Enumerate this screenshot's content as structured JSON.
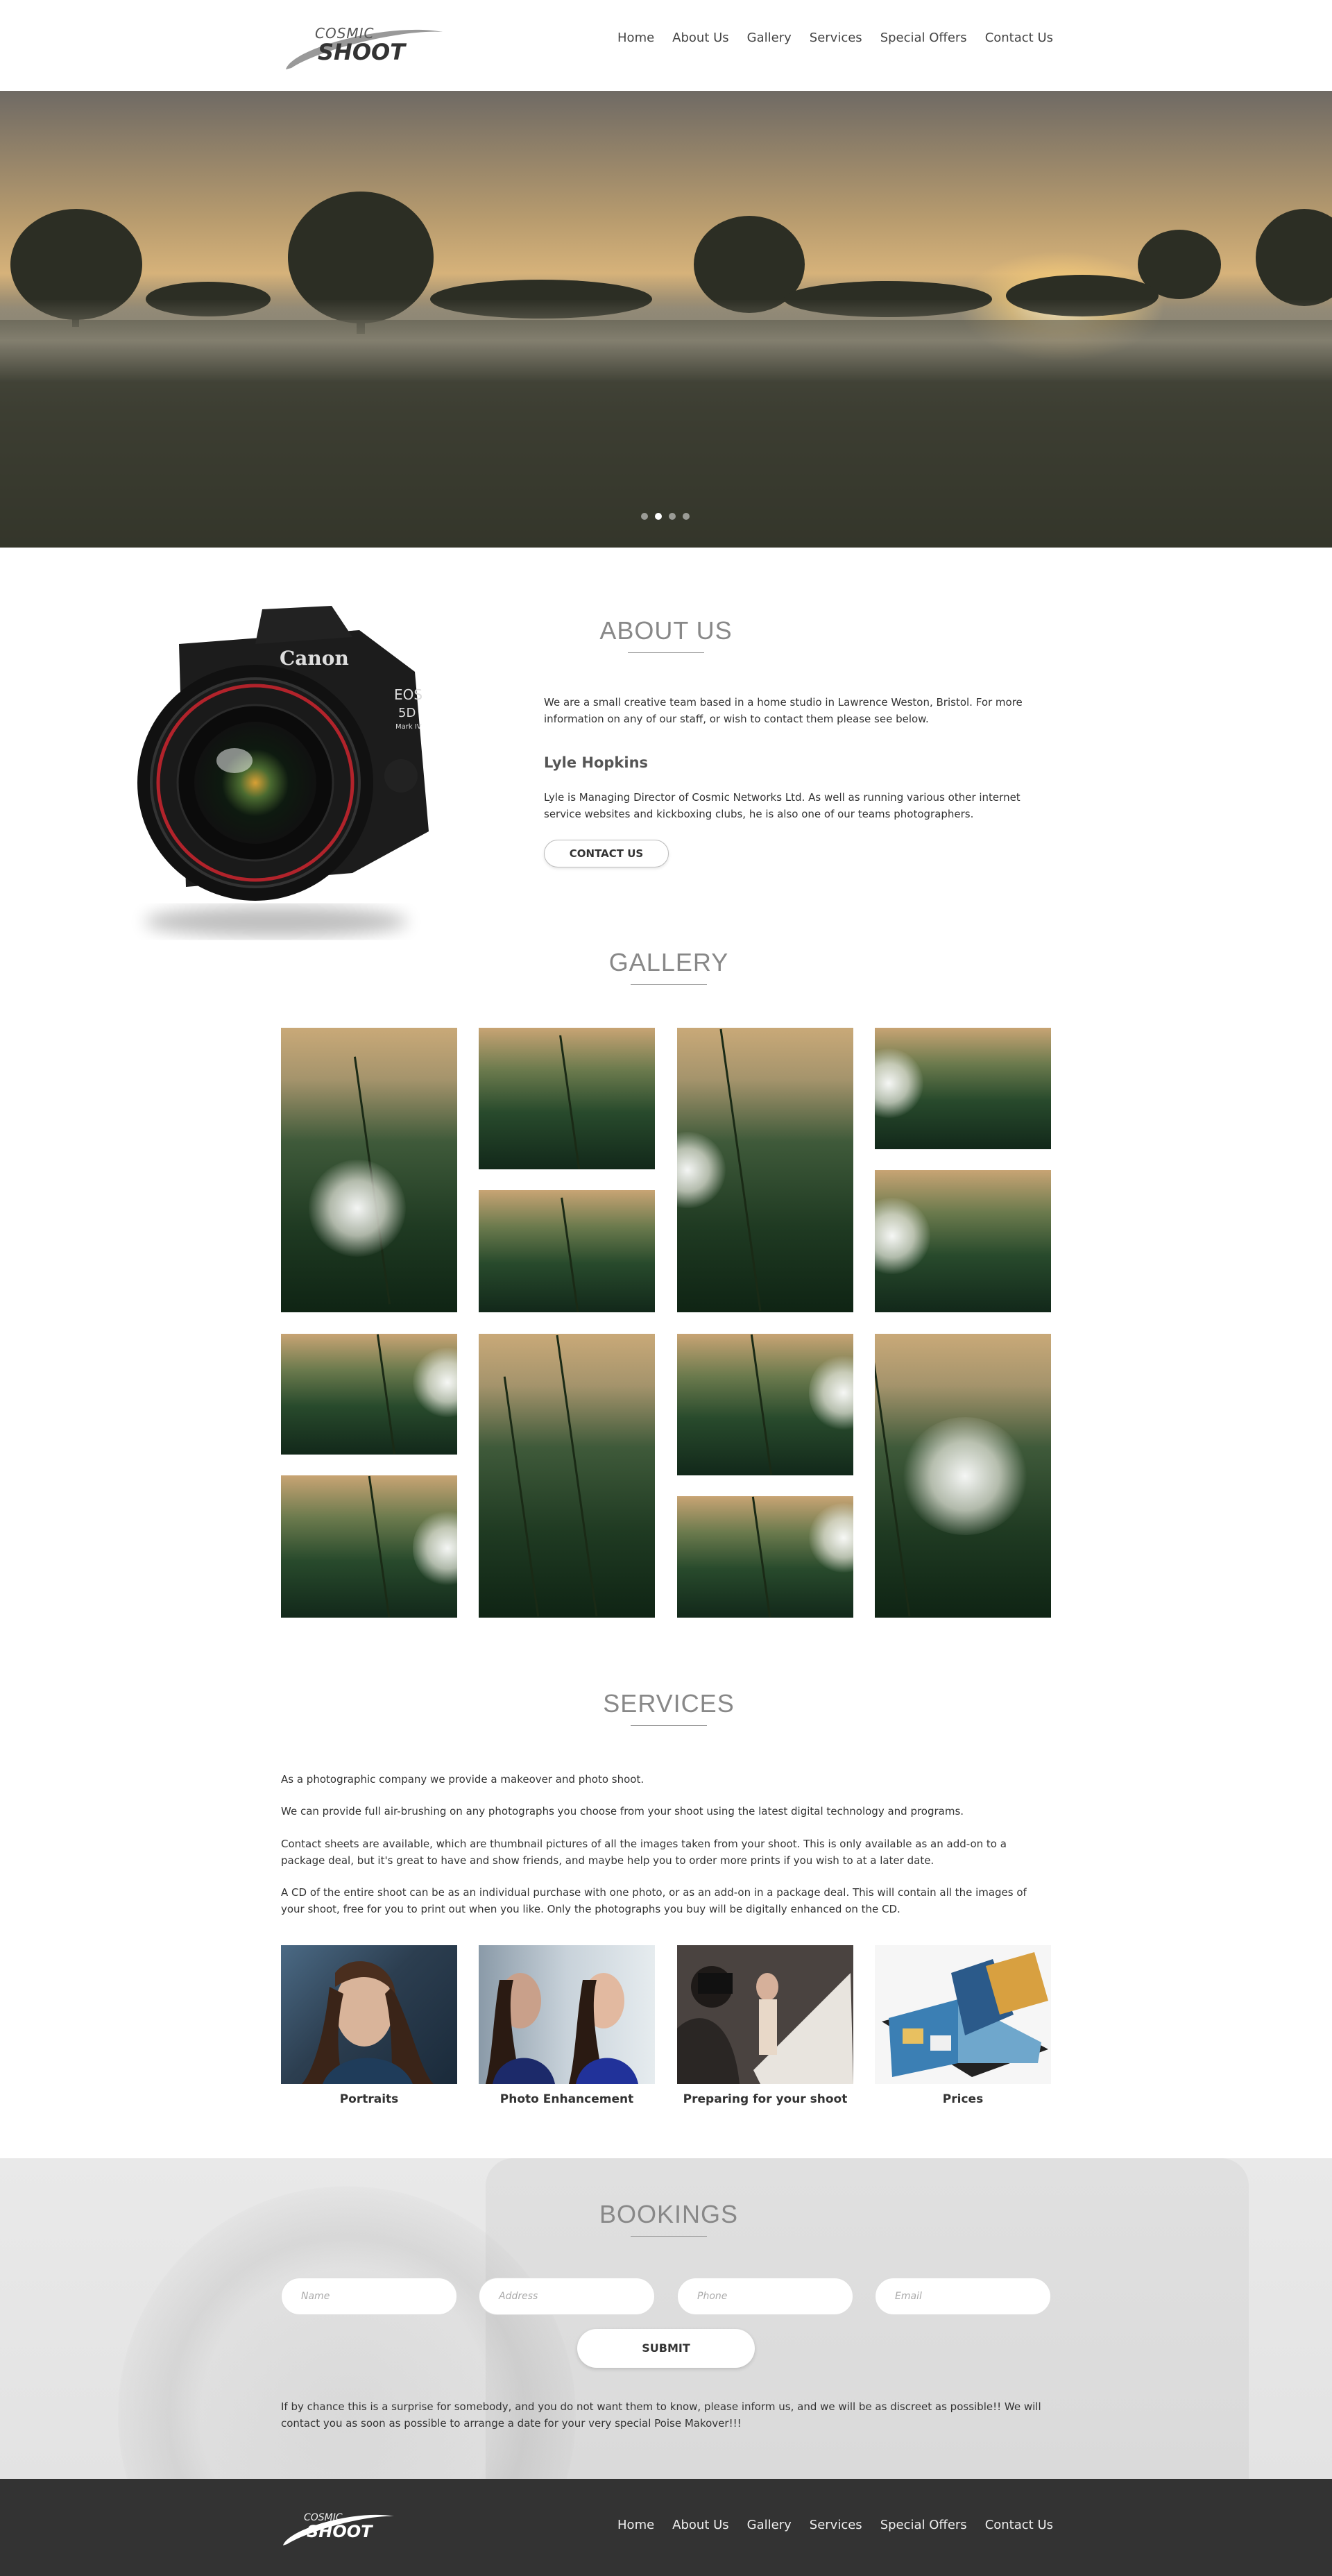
{
  "brand": {
    "line1": "COSMIC",
    "line2": "SHOOT"
  },
  "nav": [
    "Home",
    "About Us",
    "Gallery",
    "Services",
    "Special Offers",
    "Contact Us"
  ],
  "hero": {
    "slides": 4,
    "active_slide": 2
  },
  "about": {
    "title": "ABOUT US",
    "intro": "We are a small creative team based in a home studio in Lawrence Weston, Bristol. For more information on any of our staff, or wish to contact them please see below.",
    "person_name": "Lyle Hopkins",
    "person_bio": "Lyle is Managing Director of Cosmic Networks Ltd. As well as running various other internet service websites and kickboxing clubs, he is also one of our teams photographers.",
    "contact_button": "CONTACT US",
    "camera": {
      "brand": "Canon",
      "model": "EOS",
      "model_num": "5D",
      "mark": "Mark IV"
    }
  },
  "gallery": {
    "title": "GALLERY"
  },
  "services": {
    "title": "SERVICES",
    "paragraphs": [
      "As a photographic company we provide a makeover and photo shoot.",
      "We can provide full air-brushing on any photographs you choose from your shoot using the latest digital technology and programs.",
      "Contact sheets are available, which are thumbnail pictures of all the images taken from your shoot. This is only available as an add-on to a package deal, but it's great to have and show friends, and maybe help you to order more prints if you wish to at a later date.",
      "A CD of the entire shoot can be as an individual purchase with one photo, or as an add-on in a package deal. This will contain all the images of your shoot, free for you to print out when you like. Only the photographs you buy will be digitally enhanced on the CD."
    ],
    "cards": [
      "Portraits",
      "Photo Enhancement",
      "Preparing for your shoot",
      "Prices"
    ]
  },
  "bookings": {
    "title": "BOOKINGS",
    "placeholders": [
      "Name",
      "Address",
      "Phone",
      "Email"
    ],
    "submit": "SUBMIT",
    "note": "If by chance this is a surprise for somebody, and you do not want them to know, please inform us, and we will be as discreet as possible!! We will contact you as soon as possible to arrange a date for your very special Poise Makover!!!"
  }
}
